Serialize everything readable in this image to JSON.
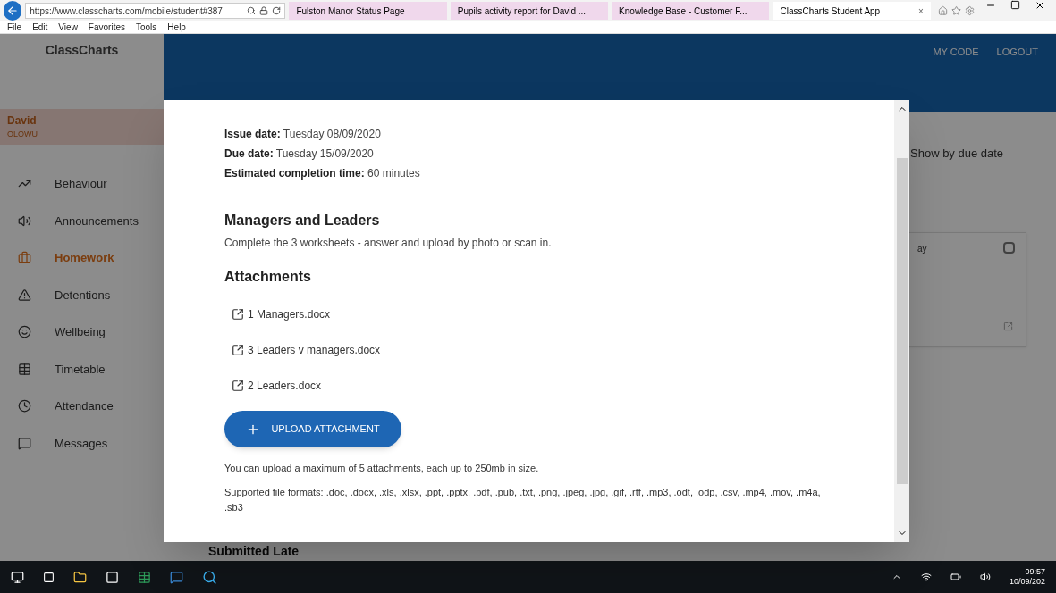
{
  "browser": {
    "address": "https://www.classcharts.com/mobile/student#387",
    "tabs": [
      {
        "label": "Fulston Manor Status Page",
        "selected": false
      },
      {
        "label": "Pupils activity report for David ...",
        "selected": false
      },
      {
        "label": "Knowledge Base - Customer F...",
        "selected": false
      },
      {
        "label": "ClassCharts Student App",
        "selected": true
      }
    ],
    "close_tab": "×",
    "menu": [
      "File",
      "Edit",
      "View",
      "Favorites",
      "Tools",
      "Help"
    ]
  },
  "app": {
    "logo": "ClassCharts",
    "header_links": [
      "MY CODE",
      "LOGOUT"
    ],
    "student": {
      "first_name": "David",
      "last_name": "OLOWU"
    },
    "nav": [
      {
        "label": "Behaviour",
        "selected": false
      },
      {
        "label": "Announcements",
        "selected": false
      },
      {
        "label": "Homework",
        "selected": true
      },
      {
        "label": "Detentions",
        "selected": false
      },
      {
        "label": "Wellbeing",
        "selected": false
      },
      {
        "label": "Timetable",
        "selected": false
      },
      {
        "label": "Attendance",
        "selected": false
      },
      {
        "label": "Messages",
        "selected": false
      }
    ],
    "sort_option": "Show by due date",
    "card_text": "ay",
    "card_checked": false,
    "section_title": "Submitted Late"
  },
  "modal": {
    "details": [
      {
        "label": "Issue date:",
        "value": "Tuesday 08/09/2020"
      },
      {
        "label": "Due date:",
        "value": "Tuesday 15/09/2020"
      },
      {
        "label": "Estimated completion time:",
        "value": "60 minutes"
      }
    ],
    "title": "Managers and Leaders",
    "description": "Complete the 3 worksheets - answer and upload by photo or scan in.",
    "attachments_heading": "Attachments",
    "attachments": [
      "1 Managers.docx",
      "3 Leaders v managers.docx",
      "2 Leaders.docx"
    ],
    "upload_button": "UPLOAD ATTACHMENT",
    "limit_note": "You can upload a maximum of 5 attachments, each up to 250mb in size.",
    "formats_note": "Supported file formats: .doc, .docx, .xls, .xlsx, .ppt, .pptx, .pdf, .pub, .txt, .png, .jpeg, .jpg, .gif, .rtf, .mp3, .odt, .odp, .csv, .mp4, .mov, .m4a, .sb3"
  },
  "taskbar": {
    "time": "09:57",
    "date": "10/09/202"
  }
}
